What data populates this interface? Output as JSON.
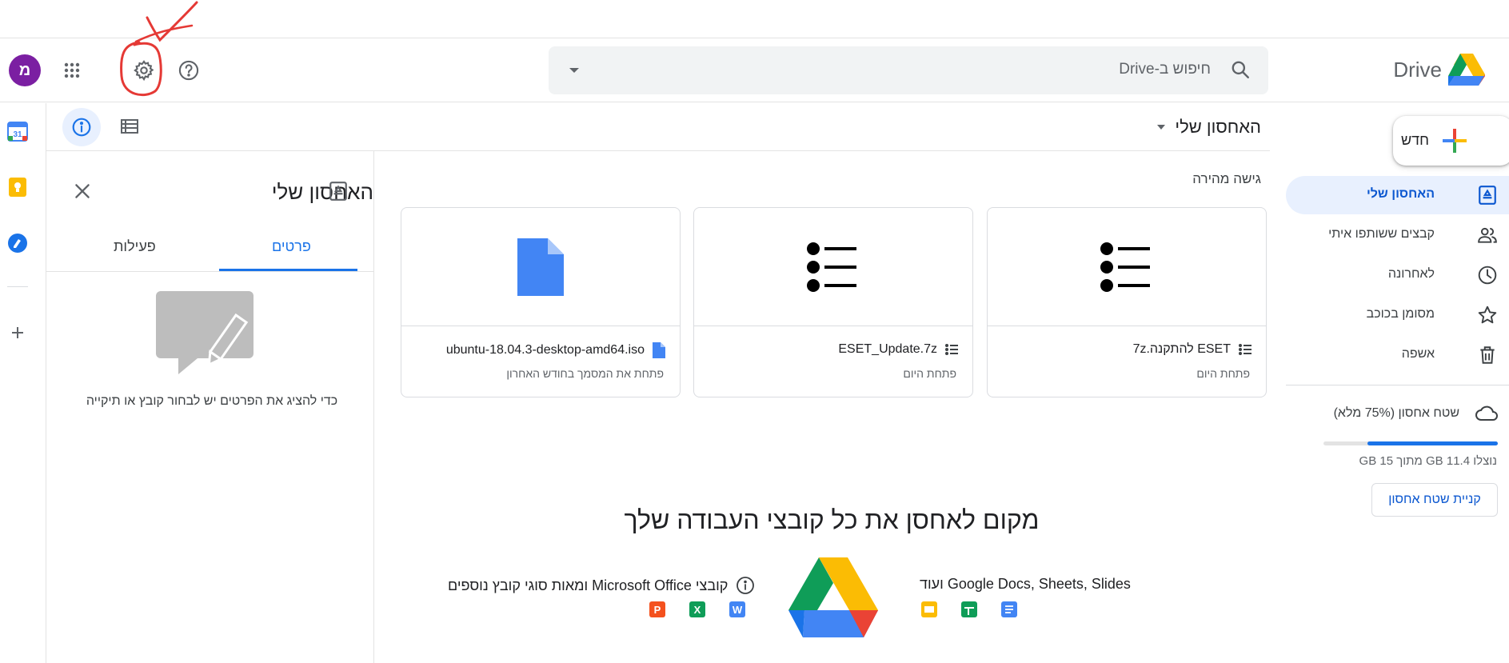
{
  "header": {
    "avatar_letter": "מ",
    "search_placeholder": "חיפוש ב-Drive",
    "brand": "Drive",
    "icons": [
      "apps-grid-icon",
      "settings-gear-icon",
      "help-icon",
      "search-icon",
      "search-options-dropdown-icon"
    ]
  },
  "toolbar": {
    "title": "האחסון שלי"
  },
  "details": {
    "title": "האחסון שלי",
    "tabs": [
      "פרטים",
      "פעילות"
    ],
    "active_tab": "פרטים",
    "empty_message": "כדי להציג את הפרטים יש לבחור קובץ או תיקייה"
  },
  "quick_access": {
    "title": "גישה מהירה",
    "cards": [
      {
        "name": "ESET להתקנה.7z",
        "subtitle": "פתחת היום",
        "icon": "archive-list-icon"
      },
      {
        "name": "ESET_Update.7z",
        "subtitle": "פתחת היום",
        "icon": "archive-list-icon"
      },
      {
        "name": "ubuntu-18.04.3-desktop-amd64.iso",
        "subtitle": "פתחת את המסמך בחודש האחרון",
        "icon": "file-icon"
      }
    ]
  },
  "promo": {
    "title": "מקום לאחסן את כל קובצי העבודה שלך",
    "left_text": "קובצי Microsoft Office ומאות סוגי קובץ נוספים",
    "right_text": "Google Docs, Sheets, Slides ועוד",
    "office_letters": [
      "W",
      "X",
      "P"
    ]
  },
  "sidebar": {
    "new_label": "חדש",
    "items": [
      {
        "label": "האחסון שלי",
        "icon": "my-drive-icon",
        "active": true
      },
      {
        "label": "קבצים ששותפו איתי",
        "icon": "shared-people-icon",
        "active": false
      },
      {
        "label": "לאחרונה",
        "icon": "clock-icon",
        "active": false
      },
      {
        "label": "מסומן בכוכב",
        "icon": "star-icon",
        "active": false
      },
      {
        "label": "אשפה",
        "icon": "trash-icon",
        "active": false
      }
    ],
    "storage_label": "שטח אחסון (75% מלא)",
    "storage_used_fraction": 0.75,
    "storage_text": "נוצלו 11.4 GB מתוך 15 GB",
    "buy_storage": "קניית שטח אחסון"
  },
  "colors": {
    "accent": "#1a73e8",
    "active_bg": "#e8f0fe",
    "avatar": "#7b1fa2",
    "annotation": "#e53935"
  }
}
